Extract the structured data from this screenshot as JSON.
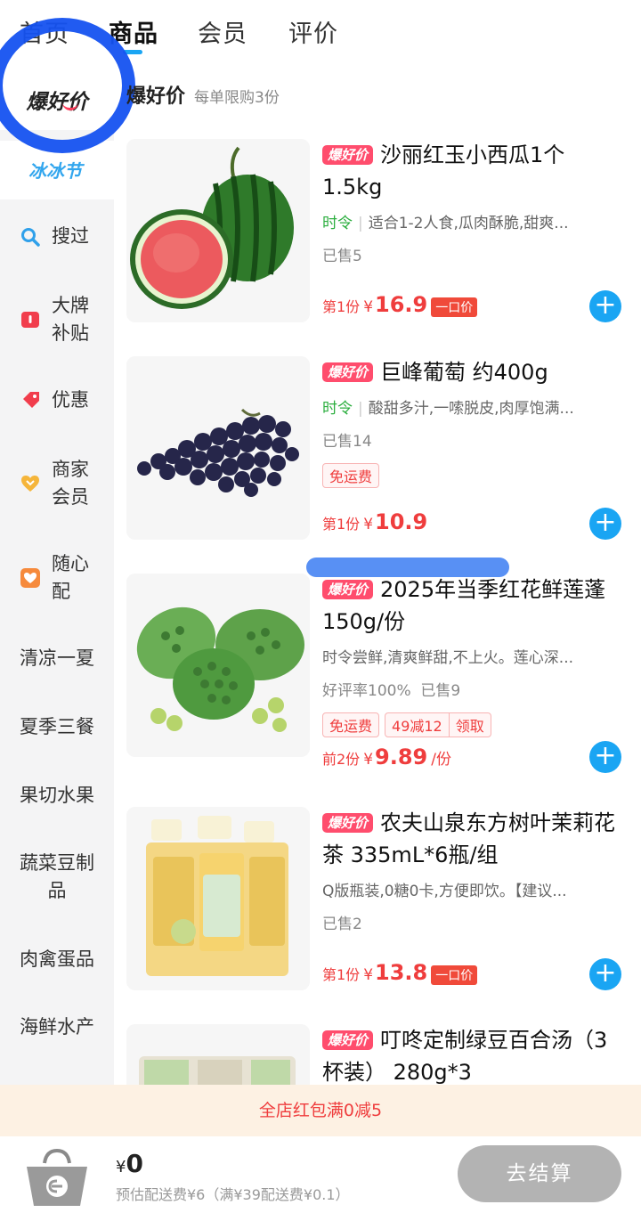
{
  "tabs": [
    "首页",
    "商品",
    "会员",
    "评价"
  ],
  "sidebar": {
    "logo": "爆好价",
    "banner": "冰冰节",
    "icon_items": [
      {
        "label": "搜过",
        "icon": "search-icon"
      },
      {
        "label": "大牌\n补贴",
        "icon": "brand-subsidy-icon"
      },
      {
        "label": "优惠",
        "icon": "discount-tag-icon"
      },
      {
        "label": "商家\n会员",
        "icon": "member-heart-icon"
      },
      {
        "label": "随心\n配",
        "icon": "bundle-heart-icon"
      }
    ],
    "categories": [
      "清凉一夏",
      "夏季三餐",
      "果切水果",
      "蔬菜豆制\n品",
      "肉禽蛋品",
      "海鲜水产"
    ]
  },
  "section": {
    "title": "爆好价",
    "subtitle": "每单限购3份"
  },
  "badge": "爆好价",
  "products": [
    {
      "title": "沙丽红玉小西瓜1个 1.5kg",
      "desc_tag": "时令",
      "desc": "适合1-2人食,瓜肉酥脆,甜爽...",
      "sold": "已售5",
      "price_prefix": "第1份",
      "price": "16.9",
      "yikou": "一口价"
    },
    {
      "title": "巨峰葡萄 约400g",
      "desc_tag": "时令",
      "desc": "酸甜多汁,一嗦脱皮,肉厚饱满...",
      "sold": "已售14",
      "tags": [
        "免运费"
      ],
      "price_prefix": "第1份",
      "price": "10.9"
    },
    {
      "title": "2025年当季红花鲜莲蓬 150g/份",
      "desc": "时令尝鲜,清爽鲜甜,不上火。莲心深...",
      "sold": "好评率100%  已售9",
      "tags": [
        "免运费"
      ],
      "coupon": [
        "49减12",
        "领取"
      ],
      "price_prefix": "前2份",
      "price": "9.89",
      "price_unit": "/份"
    },
    {
      "title": "农夫山泉东方树叶茉莉花茶 335mL*6瓶/组",
      "desc": "Q版瓶装,0糖0卡,方便即饮。【建议...",
      "sold": "已售2",
      "price_prefix": "第1份",
      "price": "13.8",
      "yikou": "一口价"
    },
    {
      "title": "叮咚定制绿豆百合汤（3杯装） 280g*3"
    }
  ],
  "currency": "¥",
  "promo": "全店红包满0减5",
  "bottom": {
    "currency": "¥",
    "total": "0",
    "shipping": "预估配送费¥6（满¥39配送费¥0.1）",
    "checkout": "去结算"
  },
  "colors": {
    "accent": "#1aa5f3",
    "price": "#ef3d3d",
    "badge": "#ff4d6d",
    "season": "#2cae3f"
  }
}
